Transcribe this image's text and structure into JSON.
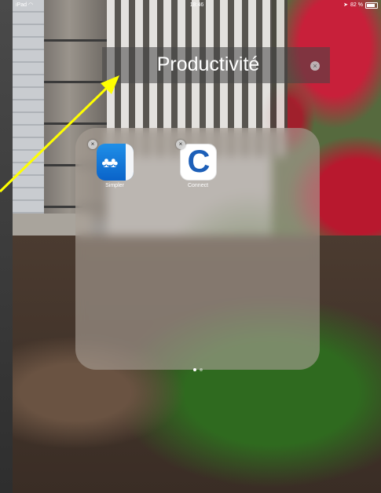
{
  "status_bar": {
    "device": "iPad",
    "wifi_icon": "wifi-icon",
    "time": "18:46",
    "battery_percent": "82 %",
    "location_icon": "location-arrow-icon"
  },
  "folder": {
    "title": "Productivité",
    "clear_glyph": "×",
    "apps": [
      {
        "name": "Simpler",
        "icon": "simpler-contacts-icon",
        "delete_glyph": "×"
      },
      {
        "name": "Connect",
        "icon": "connect-c-icon",
        "delete_glyph": "×",
        "letter": "C"
      }
    ],
    "page_count": 2,
    "current_page": 1
  },
  "annotation": {
    "arrow_color": "#ffff00"
  },
  "colors": {
    "simpler_blue": "#1f8fe8",
    "connect_blue": "#1d5fb8"
  }
}
